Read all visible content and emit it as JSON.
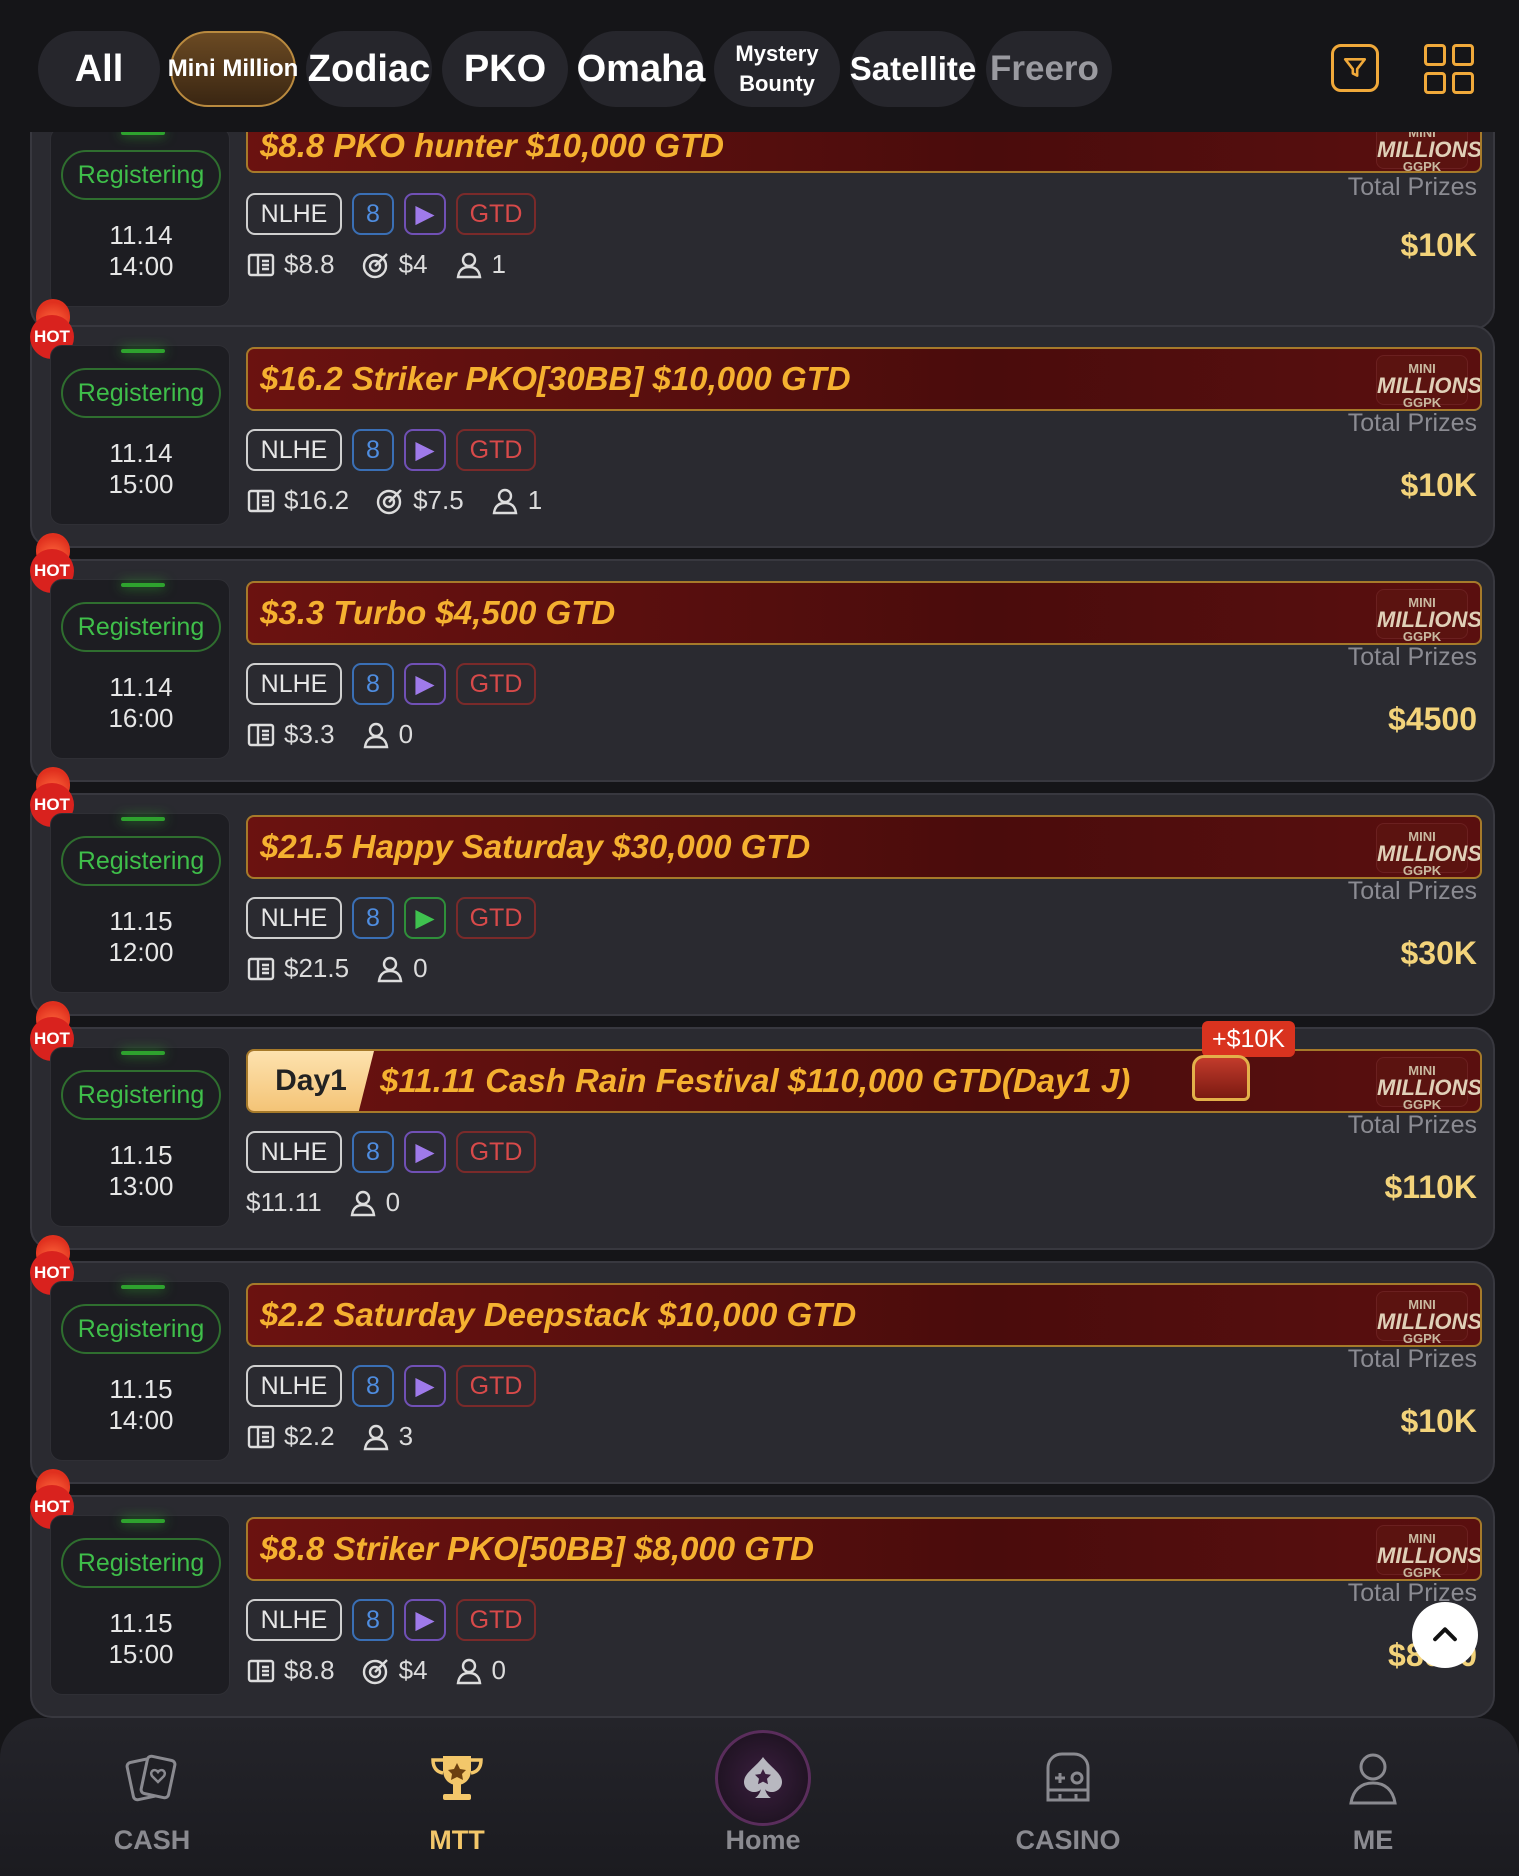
{
  "tabs": [
    {
      "label": "All"
    },
    {
      "label": "Mini Million"
    },
    {
      "label": "Zodiac"
    },
    {
      "label": "PKO"
    },
    {
      "label": "Omaha"
    },
    {
      "label_line1": "Mystery",
      "label_line2": "Bounty"
    },
    {
      "label": "Satellite"
    },
    {
      "label": "Freero"
    }
  ],
  "common": {
    "status": "Registering",
    "game": "NLHE",
    "seats": "8",
    "gtd": "GTD",
    "total_label": "Total Prizes",
    "logo_top": "MINI",
    "logo_main": "MILLIONS",
    "logo_bottom": "GGPK"
  },
  "tournaments": [
    {
      "date": "11.14",
      "time": "14:00",
      "title": "$8.8 PKO hunter $10,000 GTD",
      "buyin": "$8.8",
      "bounty": "$4",
      "players": "1",
      "total": "$10K",
      "hot": false
    },
    {
      "date": "11.14",
      "time": "15:00",
      "title": "$16.2 Striker PKO[30BB] $10,000 GTD",
      "buyin": "$16.2",
      "bounty": "$7.5",
      "players": "1",
      "total": "$10K",
      "hot": true,
      "hot_label": "HOT"
    },
    {
      "date": "11.14",
      "time": "16:00",
      "title": "$3.3 Turbo $4,500 GTD",
      "buyin": "$3.3",
      "players": "0",
      "total": "$4500",
      "hot": true,
      "hot_label": "HOT"
    },
    {
      "date": "11.15",
      "time": "12:00",
      "title": "$21.5 Happy Saturday $30,000 GTD",
      "buyin": "$21.5",
      "players": "0",
      "total": "$30K",
      "hot": true,
      "hot_label": "HOT"
    },
    {
      "date": "11.15",
      "time": "13:00",
      "day": "Day1",
      "title": "$11.11 Cash Rain Festival $110,000 GTD(Day1 J)",
      "bonus": "+$10K",
      "buyin": "$11.11",
      "players": "0",
      "total": "$110K",
      "hot": true,
      "hot_label": "HOT"
    },
    {
      "date": "11.15",
      "time": "14:00",
      "title": "$2.2 Saturday Deepstack $10,000 GTD",
      "buyin": "$2.2",
      "players": "3",
      "total": "$10K",
      "hot": true,
      "hot_label": "HOT"
    },
    {
      "date": "11.15",
      "time": "15:00",
      "title": "$8.8 Striker PKO[50BB] $8,000 GTD",
      "buyin": "$8.8",
      "bounty": "$4",
      "players": "0",
      "total": "$8000",
      "hot": true,
      "hot_label": "HOT"
    }
  ],
  "bottom_nav": [
    {
      "label": "CASH"
    },
    {
      "label": "MTT"
    },
    {
      "label": "Home"
    },
    {
      "label": "CASINO"
    },
    {
      "label": "ME"
    }
  ],
  "colors": {
    "accent": "#f0a93a",
    "registering": "#3fbf4a",
    "title": "#f5b130",
    "prize": "#f3d37a"
  }
}
